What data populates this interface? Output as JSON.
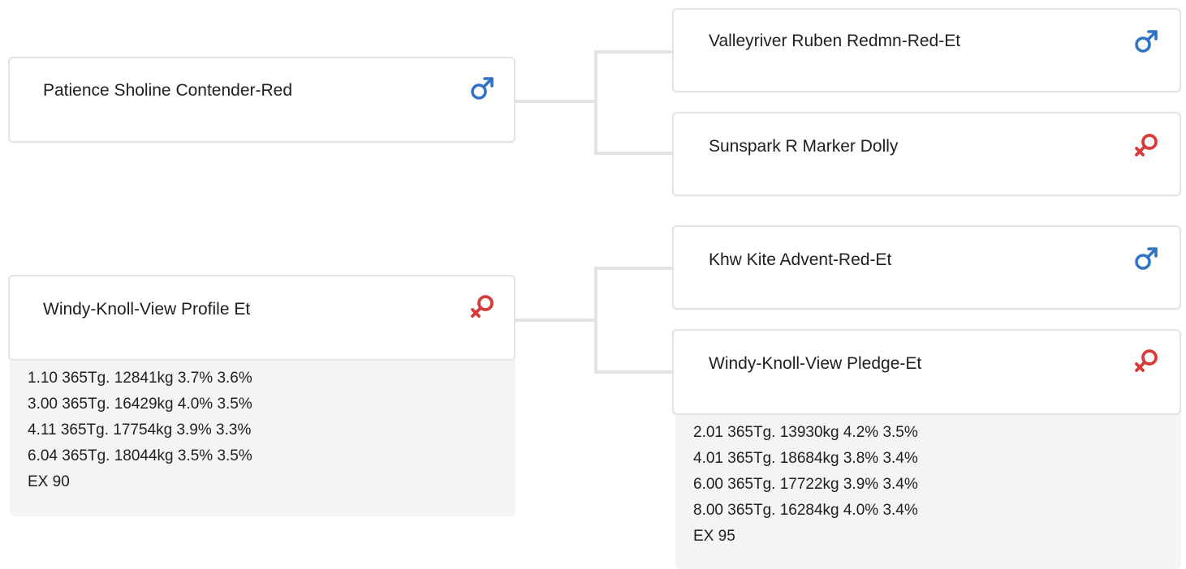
{
  "pedigree": {
    "sire": {
      "name": "Patience Sholine Contender-Red",
      "sex_icon": "male-symbol-icon",
      "sire": {
        "name": "Valleyriver Ruben Redmn-Red-Et",
        "sex_icon": "male-symbol-icon"
      },
      "dam": {
        "name": "Sunspark R Marker Dolly",
        "sex_icon": "female-symbol-icon"
      }
    },
    "dam": {
      "name": "Windy-Knoll-View Profile Et",
      "sex_icon": "female-symbol-icon",
      "records": [
        "1.10 365Tg. 12841kg 3.7% 3.6%",
        "3.00 365Tg. 16429kg 4.0% 3.5%",
        "4.11 365Tg. 17754kg 3.9% 3.3%",
        "6.04 365Tg. 18044kg 3.5% 3.5%",
        "EX 90"
      ],
      "sire": {
        "name": "Khw Kite Advent-Red-Et",
        "sex_icon": "male-symbol-icon"
      },
      "dam": {
        "name": "Windy-Knoll-View Pledge-Et",
        "sex_icon": "female-symbol-icon",
        "records": [
          "2.01 365Tg. 13930kg 4.2% 3.5%",
          "4.01 365Tg. 18684kg 3.8% 3.4%",
          "6.00 365Tg. 17722kg 3.9% 3.4%",
          "8.00 365Tg. 16284kg 4.0% 3.4%",
          "EX 95"
        ]
      }
    }
  },
  "colors": {
    "male": "#2f73c6",
    "female": "#d93a3a",
    "connector": "#e3e3e3",
    "stats_bg": "#f4f4f4"
  }
}
